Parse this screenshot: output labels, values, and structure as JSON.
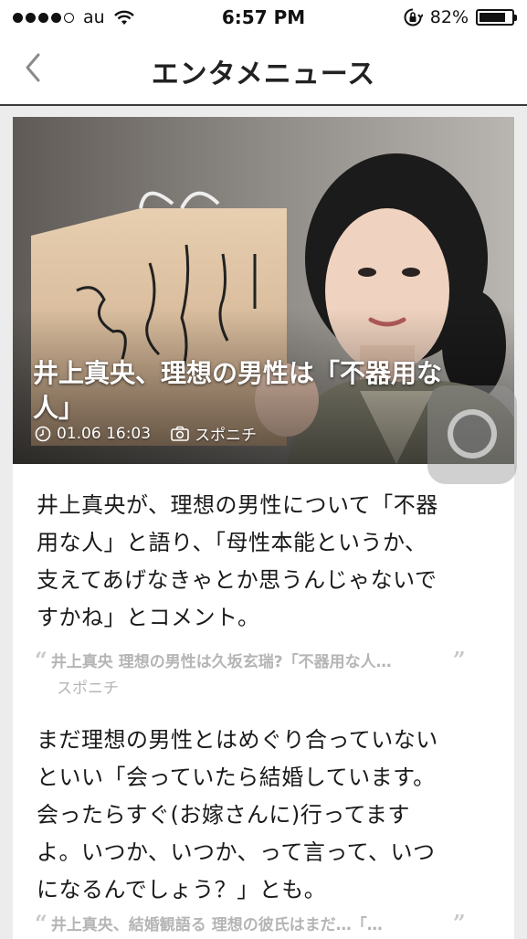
{
  "status_bar": {
    "carrier": "au",
    "time": "6:57 PM",
    "battery": "82%",
    "battery_level": 0.82
  },
  "nav": {
    "title": "エンタメニュース",
    "back_icon": "chevron-left-icon"
  },
  "article": {
    "title_line1": "井上真央、理想の男性は「不器用な",
    "title_line2": "人」",
    "date": "01.06 16:03",
    "source": "スポニチ",
    "paragraph1": [
      "井上真央が、理想の男性について「不器",
      "用な人」と語り、「母性本能というか、",
      "支えてあげなきゃとか思うんじゃないで",
      "すかね」とコメント。"
    ],
    "quote1": {
      "title": "井上真央 理想の男性は久坂玄瑞?「不器用な人…",
      "source": "スポニチ"
    },
    "paragraph2": [
      "まだ理想の男性とはめぐり合っていない",
      "といい「会っていたら結婚しています。",
      "会ったらすぐ(お嫁さんに)行ってます",
      "よ。いつか、いつか、って言って、いつ",
      "になるんでしょう？」とも。"
    ],
    "quote2": {
      "title": "井上真央、結婚観語る 理想の彼氏はまだ…「…"
    }
  },
  "colors": {
    "accent_text": "#1a1a1a",
    "quote_gray": "#b5b5b5"
  }
}
